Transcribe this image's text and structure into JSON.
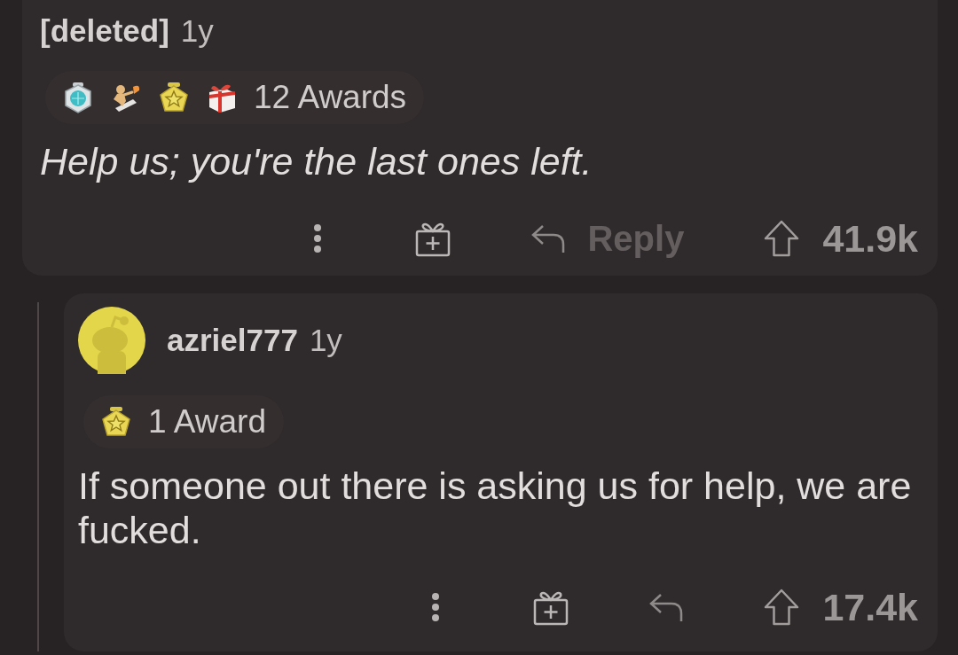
{
  "comments": [
    {
      "author": "[deleted]",
      "age": "1y",
      "avatar": false,
      "awards": [
        {
          "kind": "gem"
        },
        {
          "kind": "rocket"
        },
        {
          "kind": "star"
        },
        {
          "kind": "gift"
        }
      ],
      "awards_label": "12 Awards",
      "body": "Help us; you're the last ones left.",
      "italic": true,
      "reply_label": "Reply",
      "score": "41.9k",
      "replies": [
        {
          "author": "azriel777",
          "age": "1y",
          "avatar": true,
          "awards": [
            {
              "kind": "star"
            }
          ],
          "awards_label": "1 Award",
          "body": "If someone out there is asking us for help, we are fucked.",
          "italic": false,
          "score": "17.4k"
        }
      ]
    }
  ]
}
